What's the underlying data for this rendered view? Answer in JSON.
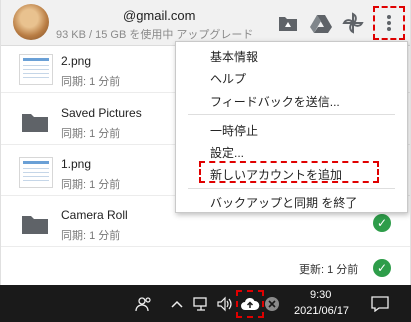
{
  "account": {
    "email": "@gmail.com",
    "storage": "93 KB / 15 GB を使用中 アップグレード"
  },
  "files": [
    {
      "name": "2.png",
      "status": "同期: 1 分前",
      "type": "image"
    },
    {
      "name": "Saved Pictures",
      "status": "同期: 1 分前",
      "type": "folder"
    },
    {
      "name": "1.png",
      "status": "同期: 1 分前",
      "type": "image"
    },
    {
      "name": "Camera Roll",
      "status": "同期: 1 分前",
      "type": "folder"
    }
  ],
  "footer": {
    "updated": "更新: 1 分前"
  },
  "menu": {
    "about": "基本情報",
    "help": "ヘルプ",
    "feedback": "フィードバックを送信...",
    "pause": "一時停止",
    "settings": "設定...",
    "add_account": "新しいアカウントを追加",
    "quit": "バックアップと同期 を終了"
  },
  "taskbar": {
    "time": "9:30",
    "date": "2021/06/17"
  },
  "colors": {
    "highlight": "#e00000",
    "sync_ok": "#2e9d4a"
  },
  "icons": [
    "drive-folder-icon",
    "drive-icon",
    "photos-pinwheel-icon",
    "more-vert-icon",
    "people-icon",
    "chevron-up-icon",
    "network-icon",
    "volume-icon",
    "backup-sync-cloud-icon",
    "close-circle-icon",
    "notification-icon"
  ]
}
